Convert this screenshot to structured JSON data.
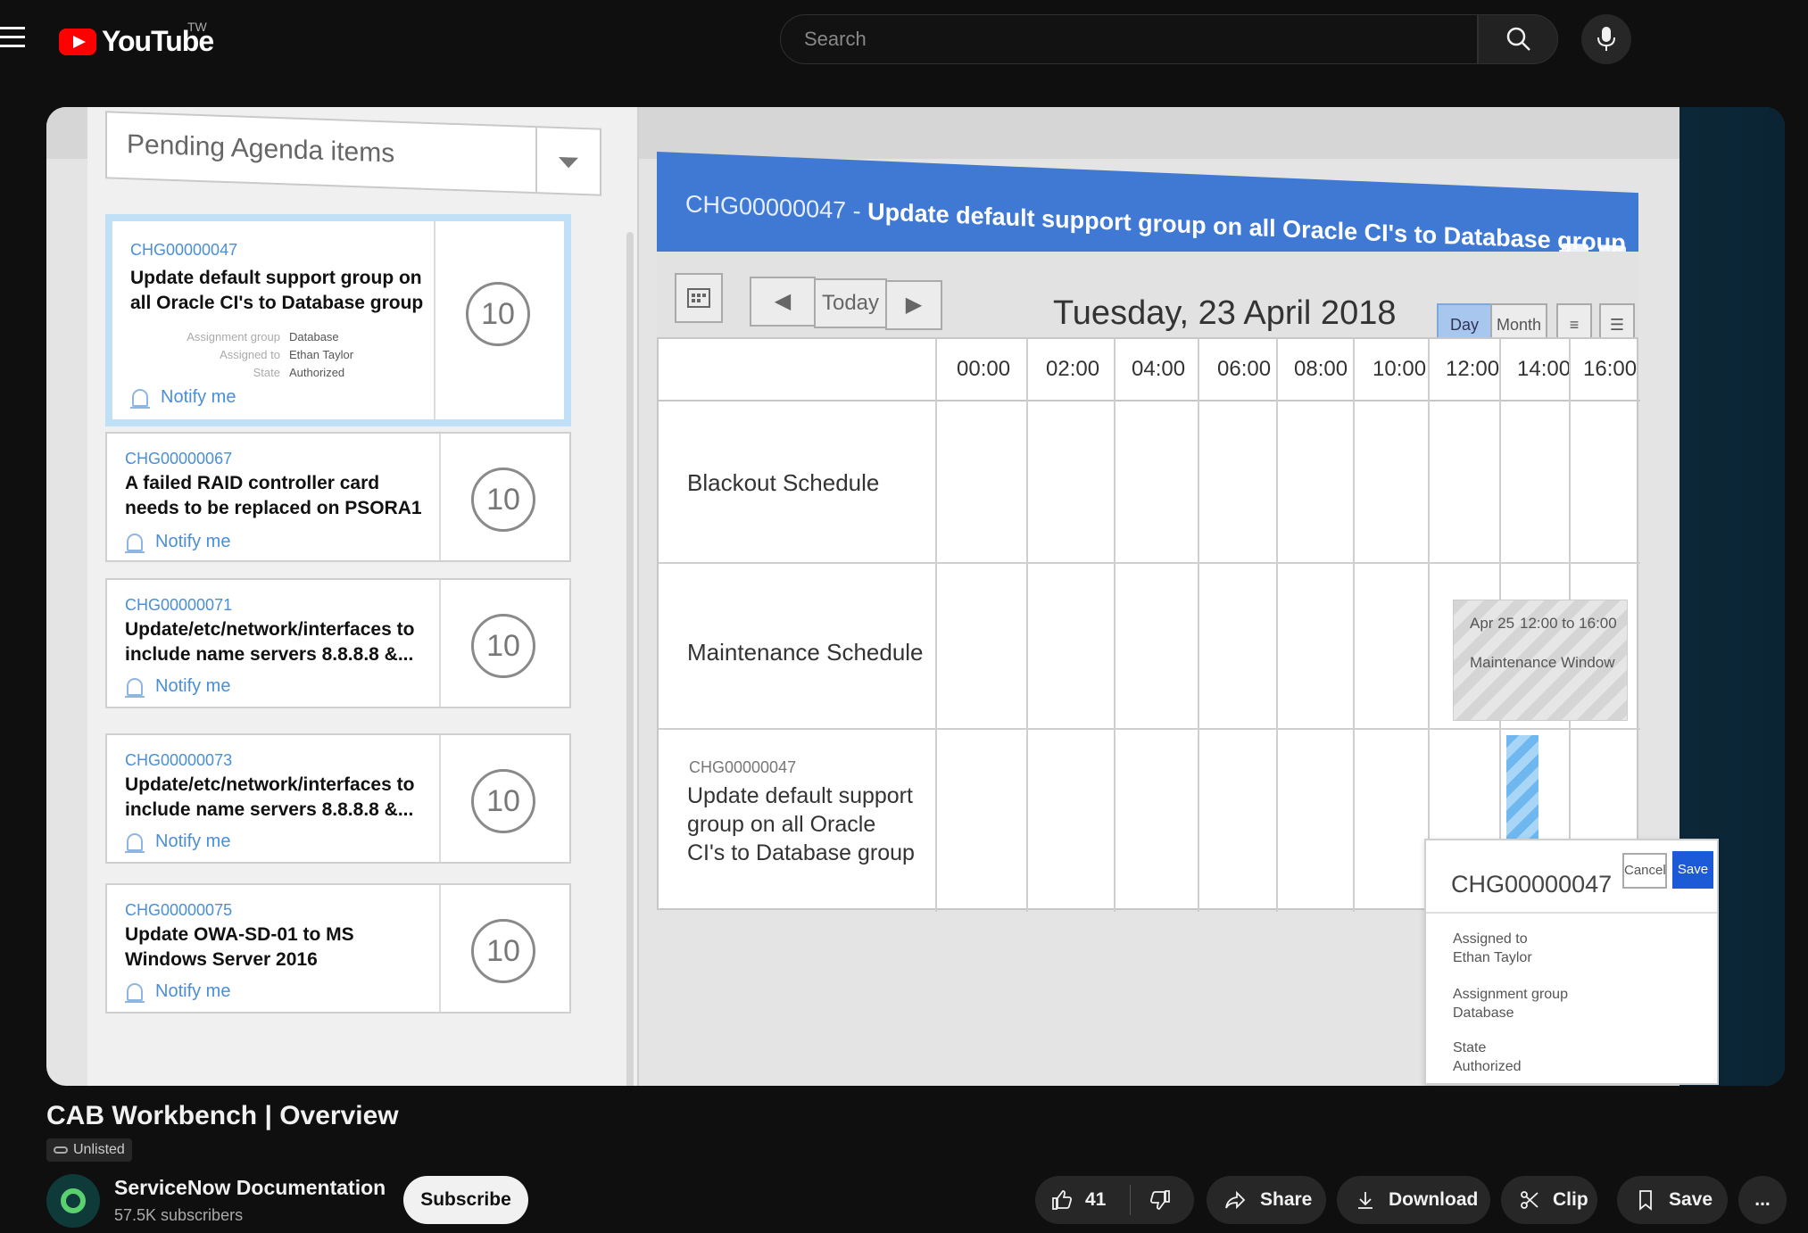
{
  "header": {
    "logo_text": "YouTube",
    "region": "TW",
    "search_placeholder": "Search"
  },
  "video": {
    "pending_label": "Pending Agenda items",
    "cards": [
      {
        "id": "CHG00000047",
        "title": "Update default support group on all Oracle CI's to Database group",
        "count": "10",
        "notify": "Notify me",
        "meta": [
          {
            "k": "Assignment group",
            "v": "Database"
          },
          {
            "k": "Assigned to",
            "v": "Ethan Taylor"
          },
          {
            "k": "State",
            "v": "Authorized"
          }
        ]
      },
      {
        "id": "CHG00000067",
        "title": "A failed RAID controller card needs to be replaced on PSORA1",
        "count": "10",
        "notify": "Notify me"
      },
      {
        "id": "CHG00000071",
        "title": "Update/etc/network/interfaces to include name servers 8.8.8.8 &...",
        "count": "10",
        "notify": "Notify me"
      },
      {
        "id": "CHG00000073",
        "title": "Update/etc/network/interfaces to include name servers 8.8.8.8 &...",
        "count": "10",
        "notify": "Notify me"
      },
      {
        "id": "CHG00000075",
        "title": "Update OWA-SD-01 to MS Windows Server 2016",
        "count": "10",
        "notify": "Notify me"
      }
    ],
    "header_id": "CHG00000047 - ",
    "header_title": "Update default support group on all Oracle CI's to Database group",
    "today_label": "Today",
    "date_label": "Tuesday, 23 April 2018",
    "view_day": "Day",
    "view_month": "Month",
    "times": [
      "00:00",
      "02:00",
      "04:00",
      "06:00",
      "08:00",
      "10:00",
      "12:00",
      "14:00",
      "16:00"
    ],
    "rows": {
      "blackout": "Blackout Schedule",
      "maintenance": "Maintenance Schedule",
      "change_id": "CHG00000047",
      "change_desc": "Update default support group on all Oracle CI's to Database group"
    },
    "maintenance_window": {
      "date": "Apr 25",
      "time": "12:00 to 16:00",
      "label": "Maintenance Window"
    },
    "popup": {
      "id": "CHG00000047",
      "cancel": "Cancel",
      "save": "Save",
      "assigned_to_label": "Assigned to",
      "assigned_to": "Ethan Taylor",
      "group_label": "Assignment group",
      "group": "Database",
      "state_label": "State",
      "state": "Authorized"
    }
  },
  "below": {
    "title": "CAB Workbench | Overview",
    "badge": "Unlisted",
    "channel": "ServiceNow Documentation",
    "subscribers": "57.5K subscribers",
    "subscribe": "Subscribe",
    "likes": "41",
    "share": "Share",
    "download": "Download",
    "clip": "Clip",
    "save": "Save",
    "more": "..."
  },
  "colors": {
    "accent_red": "#ff0000",
    "header_blue": "#3f79d4",
    "link_blue": "#4a8fd6",
    "save_blue": "#1d5ad8"
  }
}
